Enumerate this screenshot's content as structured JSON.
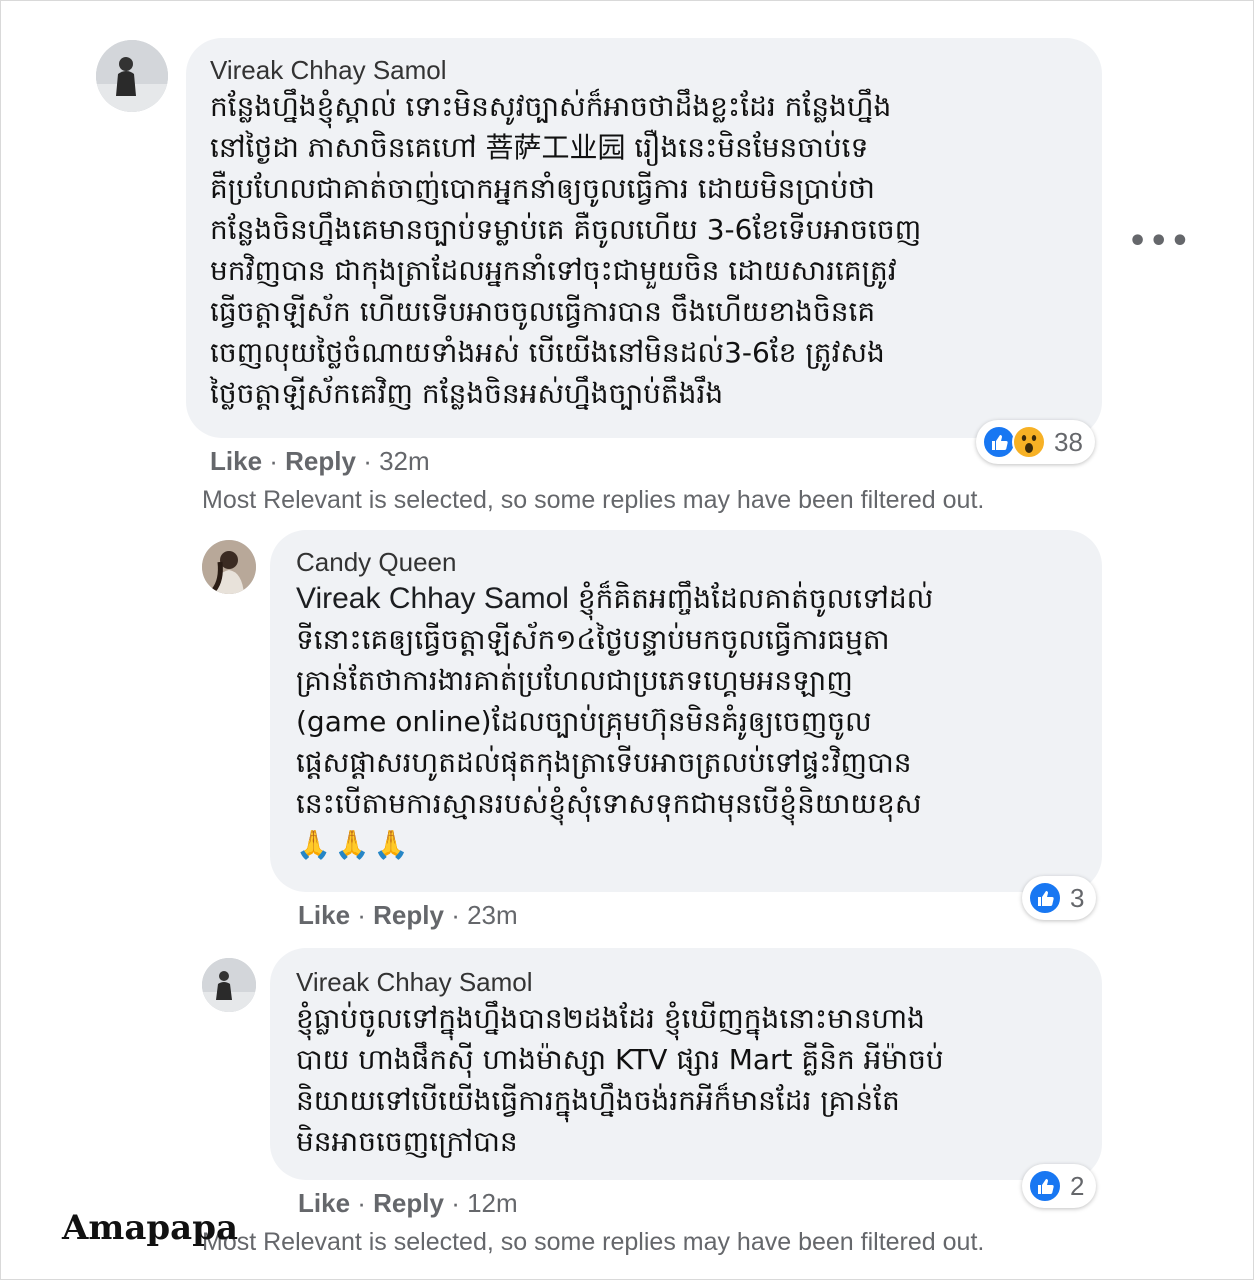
{
  "comments": [
    {
      "author": "Vireak Chhay Samol",
      "text": "កន្លែងហ្នឹងខ្ញុំស្គាល់ ទោះមិនសូវច្បាស់ក៏អាចថាដឹងខ្លះដែរ កន្លែងហ្នឹង\nនៅថ្ងៃដា ភាសាចិនគេហៅ 菩萨工业园 រឿងនេះមិនមែនចាប់ទេ\nគឺប្រហែលជាគាត់ចាញ់បោកអ្នកនាំឲ្យចូលធ្វើការ ដោយមិនប្រាប់ថា\nកន្លែងចិនហ្នឹងគេមានច្បាប់ទម្លាប់គេ គឺចូលហើយ 3-6ខែទើបអាចចេញ\nមកវិញបាន ជាកុងត្រាដែលអ្នកនាំទៅចុះជាមួយចិន ដោយសារគេត្រូវ\nធ្វើចត្តាឡីស័ក ហើយទើបអាចចូលធ្វើការបាន ចឹងហើយខាងចិនគេ\nចេញលុយថ្លៃចំណាយទាំងអស់ បើយើងនៅមិនដល់3-6ខែ ត្រូវសង\nថ្លៃចត្តាឡីស័កគេវិញ កន្លែងចិនអស់ហ្នឹងច្បាប់តឹងរឹង",
      "like": "Like",
      "reply": "Reply",
      "time": "32m",
      "reactions": "38",
      "reaction_icons": [
        "like-icon",
        "wow-icon"
      ]
    },
    {
      "author": "Candy Queen",
      "tag": "Vireak Chhay Samol",
      "text": " ខ្ញុំក៏គិតអញ្ចឹងដែលគាត់ចូលទៅដល់\nទីនោះគេឲ្យធ្វើចត្តាឡីស័ក១៤ថ្ងៃបន្ទាប់មកចូលធ្វើការធម្មតា\nគ្រាន់តែថាការងារគាត់ប្រហែលជាប្រភេទហ្គេមអនឡាញ\n(game online)ដែលច្បាប់គ្រុមហ៊ុនមិនគំរូឲ្យចេញចូល\nផ្ដេសផ្ដាសរហូតដល់ផុតកុងត្រាទើបអាចត្រលប់ទៅផ្ទះវិញបាន\nនេះបើតាមការស្មានរបស់ខ្ញុំសុំទោសទុកជាមុនបើខ្ញុំនិយាយខុស",
      "emoji": "🙏🙏🙏",
      "like": "Like",
      "reply": "Reply",
      "time": "23m",
      "reactions": "3",
      "reaction_icons": [
        "like-icon"
      ]
    },
    {
      "author": "Vireak Chhay Samol",
      "text": "ខ្ញុំធ្លាប់ចូលទៅក្នុងហ្នឹងបាន២ដងដែរ ខ្ញុំឃើញក្នុងនោះមានហាង\nបាយ ហាងផឹកស៊ី ហាងម៉ាស្សា KTV ផ្សារ Mart គ្លីនិក អីម៉ាចប់\nនិយាយទៅបើយើងធ្វើការក្នុងហ្នឹងចង់រកអីក៏មានដែរ គ្រាន់តែ\nមិនអាចចេញក្រៅបាន",
      "like": "Like",
      "reply": "Reply",
      "time": "12m",
      "reactions": "2",
      "reaction_icons": [
        "like-icon"
      ]
    }
  ],
  "filter_note": "Most Relevant is selected, so some replies may have been filtered out.",
  "more_icon": "more-options-icon",
  "watermark": "Amapapa",
  "colors": {
    "bubble": "#f0f2f5",
    "like_blue": "#1877f2",
    "meta_gray": "#65676b"
  }
}
